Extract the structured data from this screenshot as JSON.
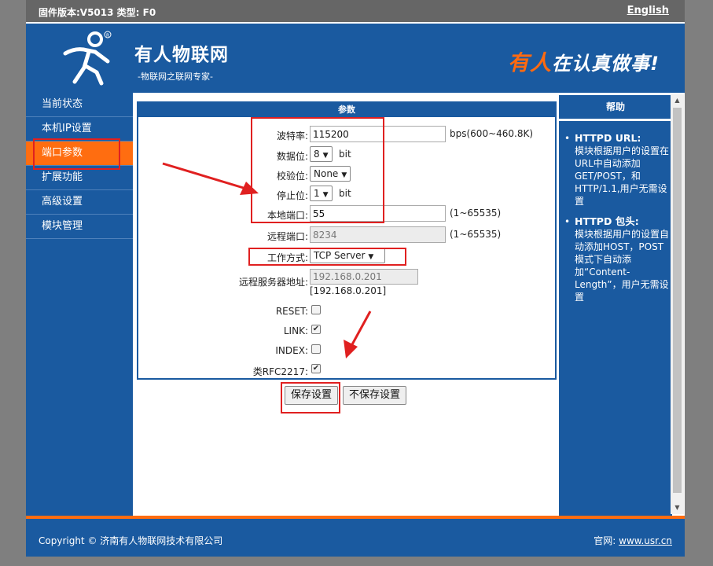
{
  "topbar": {
    "firmware": "固件版本:V5013 类型: F0",
    "language_link": "English"
  },
  "header": {
    "brand": "有人物联网",
    "slogan": "-物联网之联网专家-",
    "tagline_part1": "有人",
    "tagline_part2": "在认真做事!"
  },
  "sidebar": {
    "items": [
      {
        "label": "当前状态"
      },
      {
        "label": "本机IP设置"
      },
      {
        "label": "端口参数"
      },
      {
        "label": "扩展功能"
      },
      {
        "label": "高级设置"
      },
      {
        "label": "模块管理"
      }
    ],
    "active_index": 2
  },
  "panel": {
    "title": "参数",
    "baud": {
      "label": "波特率:",
      "value": "115200",
      "unit": "bps(600~460.8K)"
    },
    "data_bits": {
      "label": "数据位:",
      "value": "8",
      "unit": "bit"
    },
    "parity": {
      "label": "校验位:",
      "value": "None"
    },
    "stop_bits": {
      "label": "停止位:",
      "value": "1",
      "unit": "bit"
    },
    "local_port": {
      "label": "本地端口:",
      "value": "55",
      "range": "(1~65535)"
    },
    "remote_port": {
      "label": "远程端口:",
      "value": "8234",
      "range": "(1~65535)"
    },
    "work_mode": {
      "label": "工作方式:",
      "value": "TCP Server"
    },
    "remote_server": {
      "label": "远程服务器地址:",
      "value": "192.168.0.201",
      "bracket": "[192.168.0.201]"
    },
    "reset": {
      "label": "RESET:",
      "checked": false
    },
    "link": {
      "label": "LINK:",
      "checked": true
    },
    "index": {
      "label": "INDEX:",
      "checked": false
    },
    "rfc2217": {
      "label": "类RFC2217:",
      "checked": true
    }
  },
  "buttons": {
    "save": "保存设置",
    "nosave": "不保存设置"
  },
  "help": {
    "title": "帮助",
    "items": [
      {
        "title": "HTTPD URL:",
        "text": "模块根据用户的设置在URL中自动添加GET/POST，和HTTP/1.1,用户无需设置"
      },
      {
        "title": "HTTPD 包头:",
        "text": "模块根据用户的设置自动添加HOST，POST模式下自动添加“Content-Length”，用户无需设置"
      }
    ]
  },
  "footer": {
    "copyright": "Copyright © 济南有人物联网技术有限公司",
    "site_label": "官网:",
    "site_link": "www.usr.cn"
  },
  "colors": {
    "primary_blue": "#1a5aa0",
    "accent_orange": "#ff6d10",
    "annotation_red": "#e02020"
  }
}
